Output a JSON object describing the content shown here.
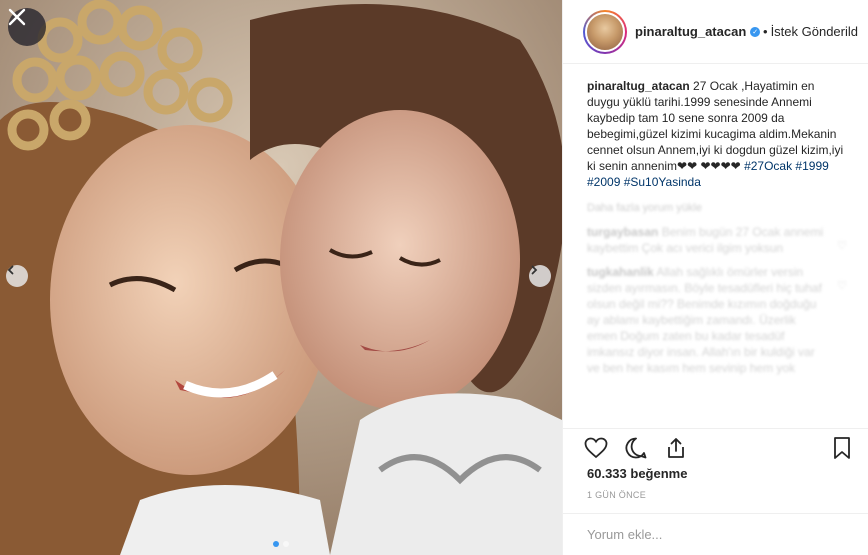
{
  "post": {
    "username": "pinaraltug_atacan",
    "follow_status": "İstek Gönderild",
    "caption_text": "27 Ocak ,Hayatimin en duygu yüklü tarihi.1999 senesinde Annemi kaybedip tam 10 sene sonra 2009 da bebegimi,güzel kizimi kucagima aldim.Mekanin cennet olsun Annem,iyi ki dogdun güzel kizim,iyi ki senin annenim❤❤ ❤❤❤❤ ",
    "caption_tags": "#27Ocak #1999 #2009 #Su10Yasinda",
    "load_more_comments": "Daha fazla yorum yükle",
    "comments": [
      {
        "user": "turgaybasan",
        "text": "Benim bugün 27 Ocak annemi kaybettim Çok acı verici ilgim yoksun"
      },
      {
        "user": "tugkahanlik",
        "text": "Allah sağlıklı ömürler versin sizden ayırmasın. Böyle tesadüfleri hiç tuhaf olsun değil mi?? Benimde kızımın doğduğu ay ablamı kaybettiğim zamandı. Üzerlik emen Doğum zaten bu kadar tesadüf imkansız diyor insan. Allah'ın bir kuldiği var ve ben her kasım hem sevinip hem yok"
      }
    ],
    "likes": "60.333 beğenme",
    "time": "1 GÜN ÖNCE",
    "comment_placeholder": "Yorum ekle..."
  },
  "icons": {
    "close": "close-icon",
    "prev": "chevron-left-icon",
    "next": "chevron-right-icon",
    "like": "heart-icon",
    "comment": "comment-bubble-icon",
    "share": "share-icon",
    "save": "bookmark-icon"
  },
  "colors": {
    "link": "#003569",
    "accent_blue": "#3897f0",
    "text": "#262626",
    "muted": "#999999",
    "border": "#efefef"
  }
}
